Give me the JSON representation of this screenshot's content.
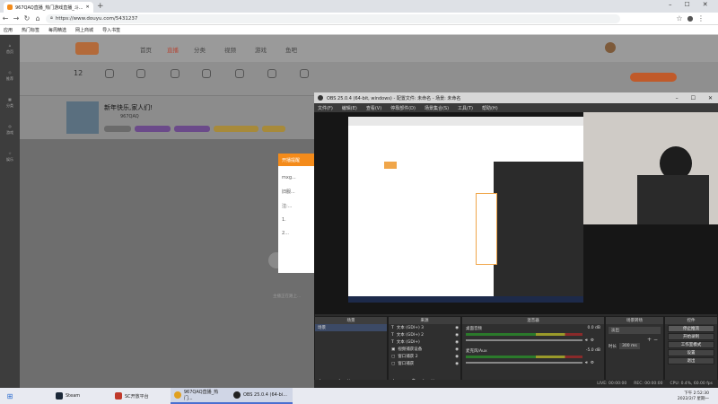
{
  "browser": {
    "tabs": [
      {
        "label": "967QAQ直播_热门游戏直播_斗..."
      }
    ],
    "url": "https://www.douyu.com/5431237",
    "bookmarks": [
      "应用",
      "热门标签",
      "每周精选",
      "网上商城",
      "导入书签"
    ]
  },
  "site": {
    "left_nav": [
      "首页",
      "推荐",
      "分类",
      "游戏",
      "娱乐"
    ],
    "nav": [
      "首页",
      "直播",
      "分类",
      "视频",
      "游戏",
      "鱼吧"
    ],
    "subscribers_count": "12",
    "stream_title": "新年快乐,家人们!",
    "streamer_name": "967QAQ",
    "popup_title": "开播提醒",
    "popup_lines": [
      "mxg...",
      "旧服...",
      "注:...",
      "1.",
      "2..."
    ],
    "video_caption": "主播正在路上..."
  },
  "obs": {
    "title": "OBS 25.0.4 (64-bit, windows) - 配置文件: 未命名 - 场景: 未命名",
    "menu": [
      "文件(F)",
      "编辑(E)",
      "查看(V)",
      "停靠部件(D)",
      "场景集合(S)",
      "工具(T)",
      "帮助(H)"
    ],
    "docks": {
      "scenes": {
        "title": "场景",
        "items": [
          "场景"
        ]
      },
      "sources": {
        "title": "来源",
        "items": [
          "文本 (GDI+) 3",
          "文本 (GDI+) 2",
          "文本 (GDI+)",
          "视频捕获设备",
          "窗口捕获 2",
          "窗口捕获"
        ]
      },
      "mixer": {
        "title": "混音器",
        "channels": [
          {
            "name": "桌面音频",
            "db": "0.0 dB"
          },
          {
            "name": "麦克风/Aux",
            "db": "-5.0 dB"
          }
        ]
      },
      "transitions": {
        "title": "场景转场",
        "type": "淡出",
        "duration_label": "时长",
        "duration": "300 ms"
      },
      "controls": {
        "title": "控件",
        "buttons": [
          "停止推流",
          "开始录制",
          "工作室模式",
          "设置",
          "退出"
        ]
      }
    },
    "status": {
      "live": "LIVE: 00:00:00",
      "rec": "REC: 00:00:00",
      "cpu": "CPU: 0.4%, 60.00 fps"
    }
  },
  "taskbar": {
    "items": [
      {
        "label": "Steam"
      },
      {
        "label": "SC开放平台"
      },
      {
        "label": "967QAQ直播_热门..."
      },
      {
        "label": "OBS 25.0.4 (64-bi..."
      }
    ],
    "time": "下午 2:52:30",
    "date": "2022/2/7 星期一"
  }
}
